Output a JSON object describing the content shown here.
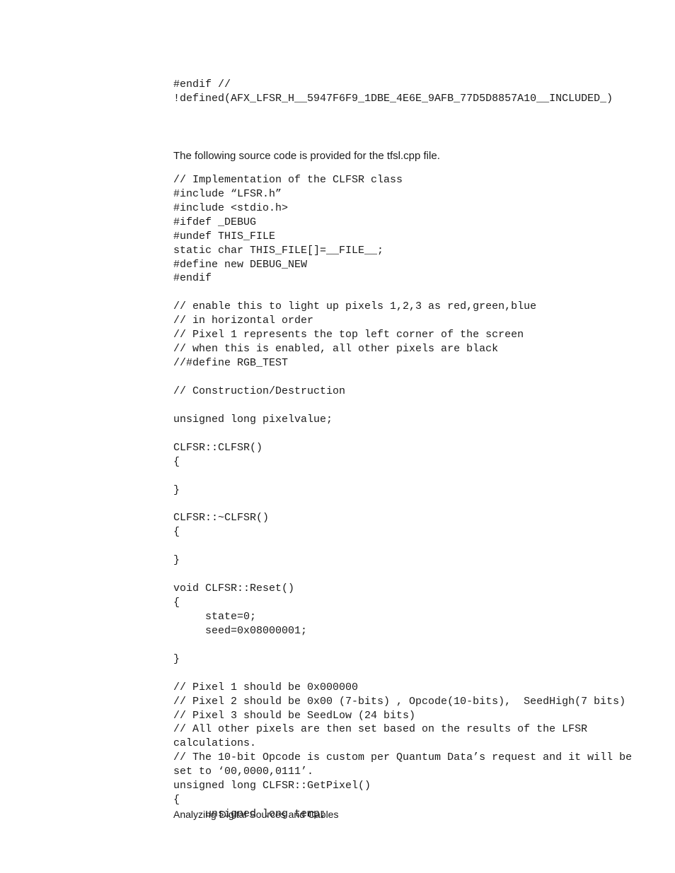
{
  "code_top": "#endif //\n!defined(AFX_LFSR_H__5947F6F9_1DBE_4E6E_9AFB_77D5D8857A10__INCLUDED_)",
  "intro_text": "The following source code is provided for the tfsl.cpp file.",
  "code_main": "// Implementation of the CLFSR class\n#include “LFSR.h”\n#include <stdio.h>\n#ifdef _DEBUG\n#undef THIS_FILE\nstatic char THIS_FILE[]=__FILE__;\n#define new DEBUG_NEW\n#endif\n\n// enable this to light up pixels 1,2,3 as red,green,blue\n// in horizontal order\n// Pixel 1 represents the top left corner of the screen\n// when this is enabled, all other pixels are black\n//#define RGB_TEST\n\n// Construction/Destruction\n\nunsigned long pixelvalue;\n\nCLFSR::CLFSR()\n{\n\n}\n\nCLFSR::~CLFSR()\n{\n\n}\n\nvoid CLFSR::Reset()\n{\n     state=0;\n     seed=0x08000001;\n\n}\n\n// Pixel 1 should be 0x000000\n// Pixel 2 should be 0x00 (7-bits) , Opcode(10-bits),  SeedHigh(7 bits)\n// Pixel 3 should be SeedLow (24 bits)\n// All other pixels are then set based on the results of the LFSR\ncalculations.\n// The 10-bit Opcode is custom per Quantum Data’s request and it will be\nset to ‘00,0000,0111’.\nunsigned long CLFSR::GetPixel()\n{\n     unsigned long temp;",
  "footer": "Analyzing Digital Sources and Cables"
}
